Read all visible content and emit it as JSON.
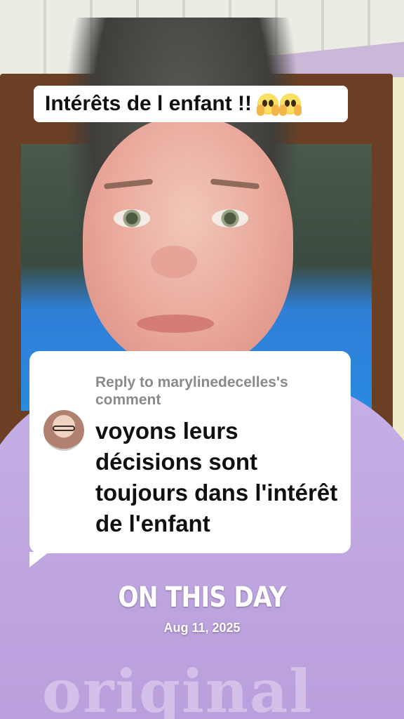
{
  "caption": {
    "text": "Intérêts de l enfant !!",
    "emoji": [
      "face-with-open-eyes-and-hand-over-mouth-emoji",
      "face-with-open-eyes-and-hand-over-mouth-emoji"
    ]
  },
  "reply": {
    "header": "Reply to marylinedecelles's comment",
    "body": "voyons leurs décisions sont toujours dans l'intérêt de l'enfant",
    "avatar_icon": "commenter-avatar"
  },
  "on_this_day": {
    "title": "ON THIS DAY",
    "date": "Aug 11, 2025"
  },
  "sweater_print": "oriqinal",
  "colors": {
    "card_background": "#ffffff",
    "reply_header": "#8a8a8a",
    "sweater": "#c6afe6",
    "door_frame": "#6b3f24"
  }
}
